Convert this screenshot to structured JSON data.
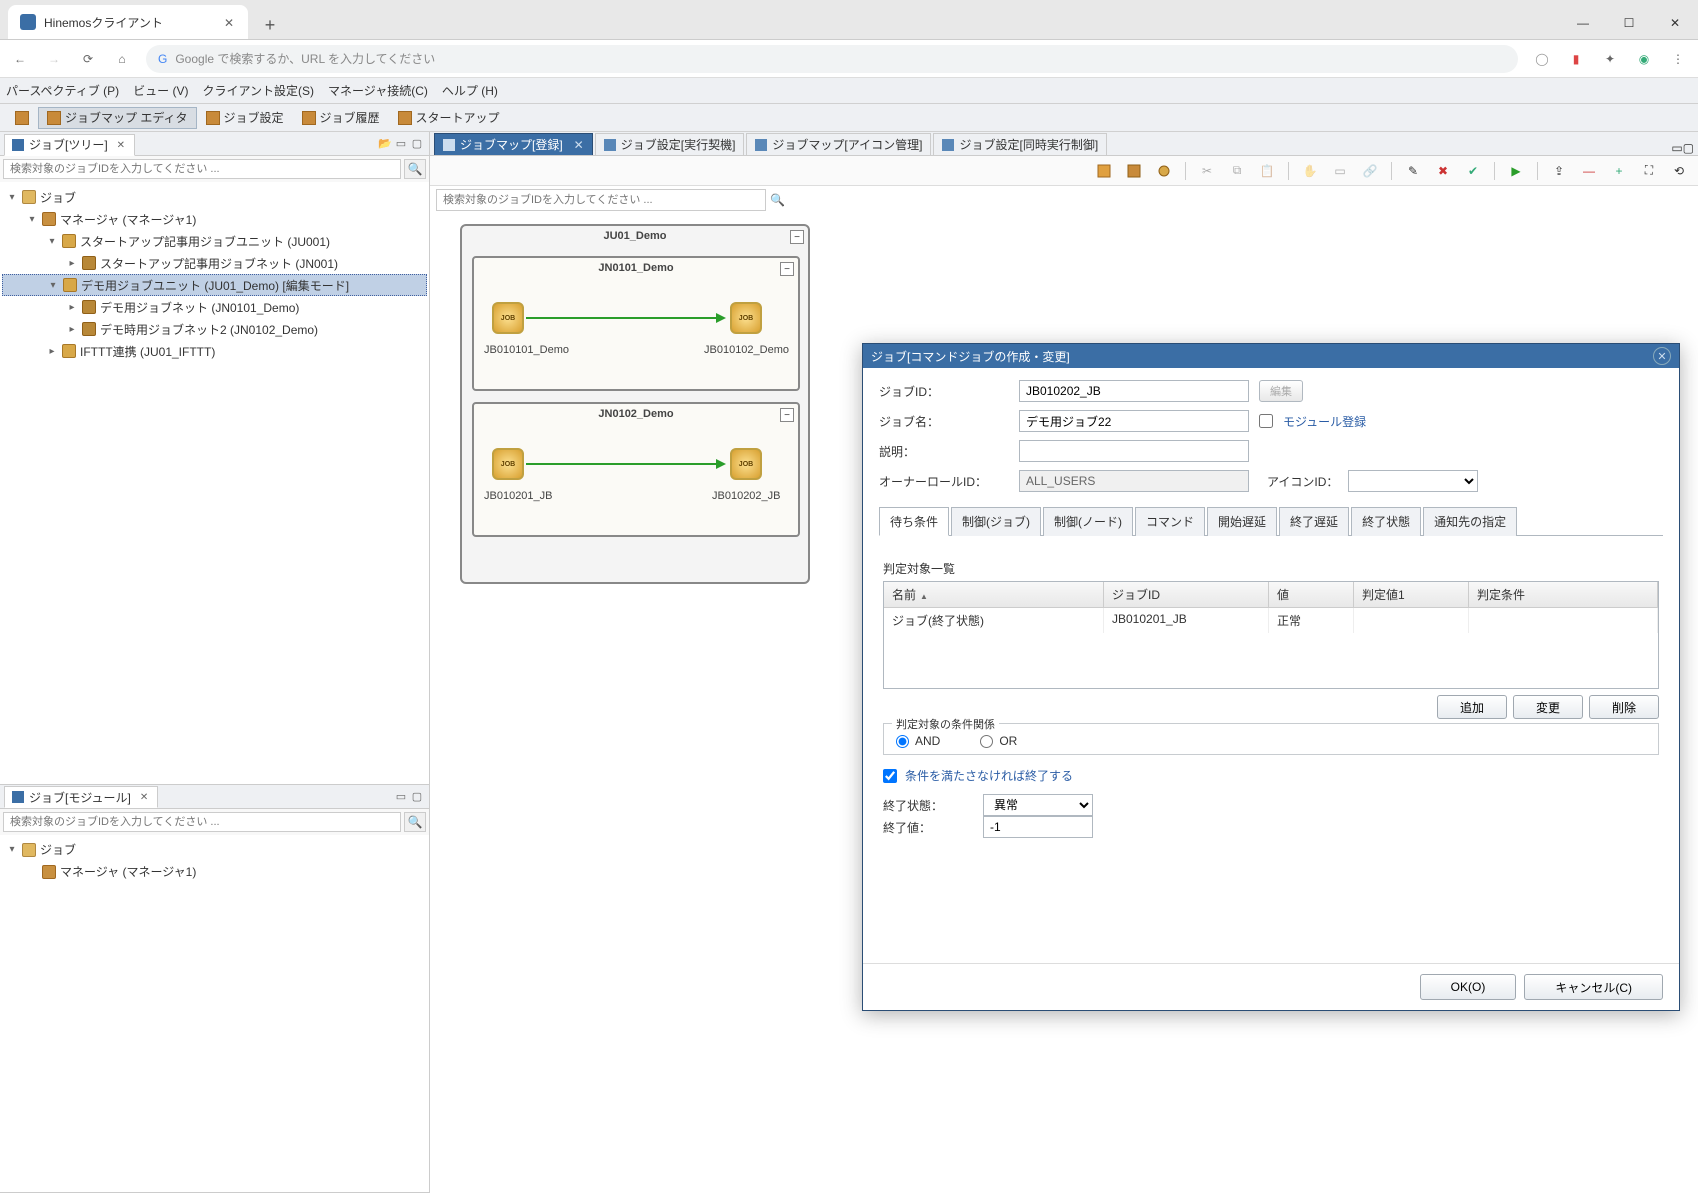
{
  "browser": {
    "tab_title": "Hinemosクライアント",
    "placeholder": "Google で検索するか、URL を入力してください"
  },
  "menubar": [
    "パースペクティブ (P)",
    "ビュー (V)",
    "クライアント設定(S)",
    "マネージャ接続(C)",
    "ヘルプ (H)"
  ],
  "perspectives": [
    "ジョブマップ エディタ",
    "ジョブ設定",
    "ジョブ履歴",
    "スタートアップ"
  ],
  "left_panel": {
    "tab": "ジョブ[ツリー]",
    "search_placeholder": "検索対象のジョブIDを入力してください ...",
    "tree": {
      "root": "ジョブ",
      "manager": "マネージャ (マネージャ1)",
      "unit1": "スタートアップ記事用ジョブユニット (JU001)",
      "net1": "スタートアップ記事用ジョブネット (JN001)",
      "unit2": "デモ用ジョブユニット (JU01_Demo) [編集モード]",
      "net2": "デモ用ジョブネット (JN0101_Demo)",
      "net3": "デモ時用ジョブネット2 (JN0102_Demo)",
      "unit3": "IFTTT連携 (JU01_IFTTT)"
    }
  },
  "module_panel": {
    "tab": "ジョブ[モジュール]",
    "search_placeholder": "検索対象のジョブIDを入力してください ...",
    "root": "ジョブ",
    "manager": "マネージャ (マネージャ1)"
  },
  "editor_tabs": [
    "ジョブマップ[登録]",
    "ジョブ設定[実行契機]",
    "ジョブマップ[アイコン管理]",
    "ジョブ設定[同時実行制御]"
  ],
  "editor": {
    "search_placeholder": "検索対象のジョブIDを入力してください ...",
    "unit_title": "JU01_Demo",
    "net1_title": "JN0101_Demo",
    "net2_title": "JN0102_Demo",
    "job1": "JB010101_Demo",
    "job2": "JB010102_Demo",
    "job3": "JB010201_JB",
    "job4": "JB010202_JB"
  },
  "dialog": {
    "title": "ジョブ[コマンドジョブの作成・変更]",
    "labels": {
      "job_id": "ジョブID：",
      "edit": "編集",
      "job_name": "ジョブ名：",
      "module_reg": "モジュール登録",
      "description": "説明：",
      "owner_role": "オーナーロールID：",
      "icon_id": "アイコンID："
    },
    "values": {
      "job_id": "JB010202_JB",
      "job_name": "デモ用ジョブ22",
      "description": "",
      "owner_role": "ALL_USERS",
      "icon_id": ""
    },
    "tabs": [
      "待ち条件",
      "制御(ジョブ)",
      "制御(ノード)",
      "コマンド",
      "開始遅延",
      "終了遅延",
      "終了状態",
      "通知先の指定"
    ],
    "table": {
      "title": "判定対象一覧",
      "headers": [
        "名前",
        "ジョブID",
        "値",
        "判定値1",
        "判定条件"
      ],
      "row": {
        "name": "ジョブ(終了状態)",
        "job_id": "JB010201_JB",
        "value": "正常",
        "val1": "",
        "cond": ""
      }
    },
    "buttons": {
      "add": "追加",
      "change": "変更",
      "delete": "削除"
    },
    "cond_rel": {
      "title": "判定対象の条件関係",
      "and": "AND",
      "or": "OR"
    },
    "checkbox": "条件を満たさなければ終了する",
    "end_status_label": "終了状態：",
    "end_status_val": "異常",
    "end_value_label": "終了値：",
    "end_value_val": "-1",
    "ok": "OK(O)",
    "cancel": "キャンセル(C)"
  }
}
